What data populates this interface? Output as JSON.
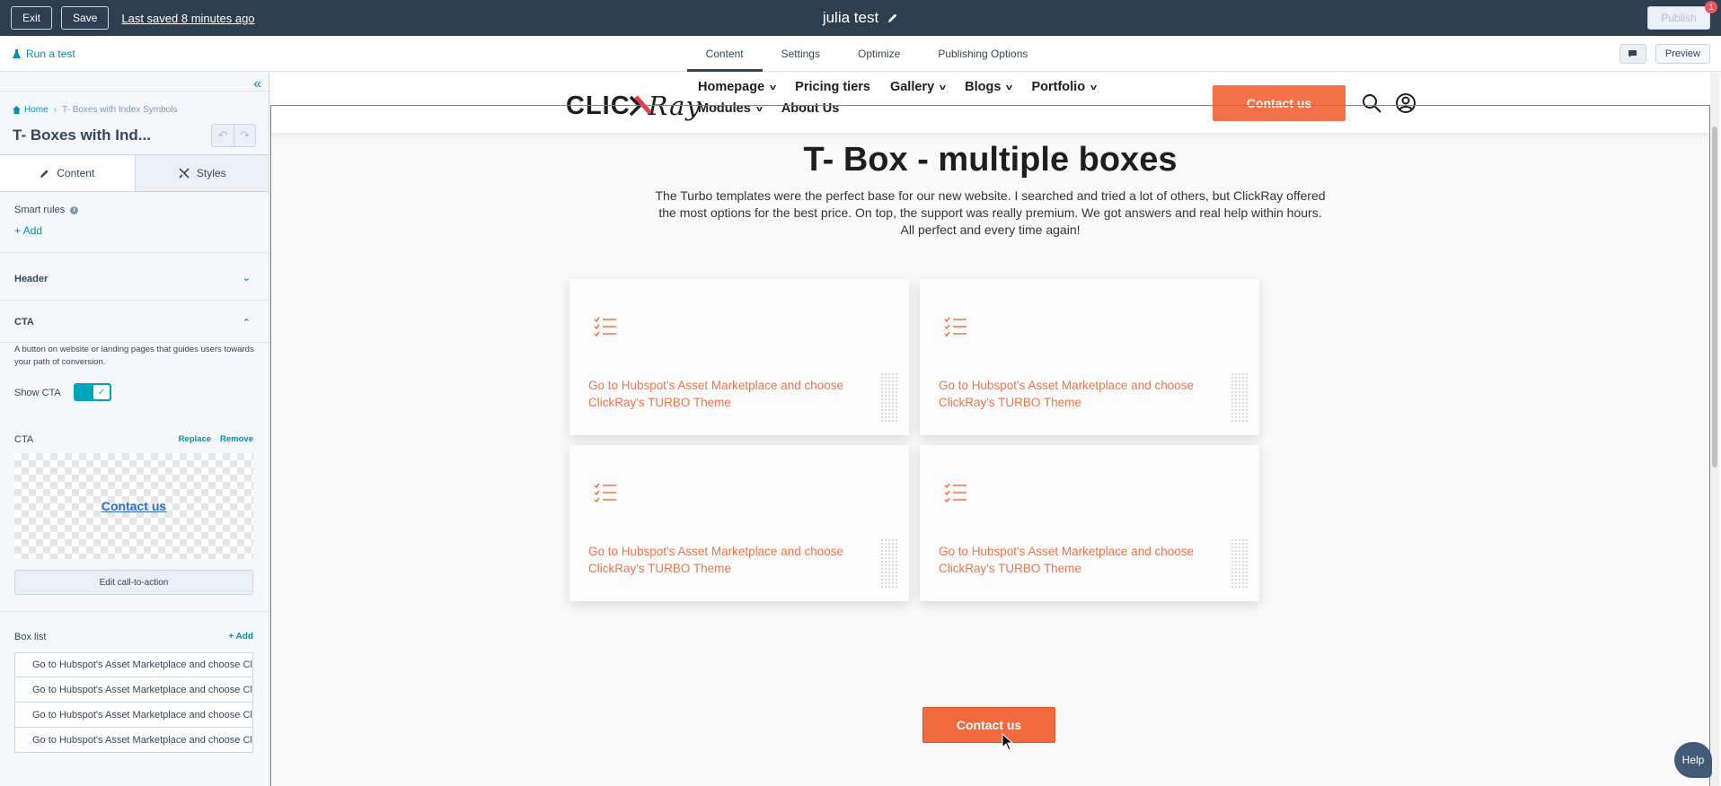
{
  "topbar": {
    "exit_label": "Exit",
    "save_label": "Save",
    "saved_text": "Last saved 8 minutes ago",
    "page_name": "julia test",
    "publish_label": "Publish",
    "notification_count": "1"
  },
  "subbar": {
    "run_test": "Run a test",
    "tabs": [
      {
        "label": "Content",
        "active": true
      },
      {
        "label": "Settings",
        "active": false
      },
      {
        "label": "Optimize",
        "active": false
      },
      {
        "label": "Publishing Options",
        "active": false
      }
    ],
    "preview_label": "Preview"
  },
  "sidebar": {
    "breadcrumb_home": "Home",
    "breadcrumb_current": "T- Boxes with Index Symbols",
    "module_title": "T- Boxes with Ind...",
    "tab_content": "Content",
    "tab_styles": "Styles",
    "smart_rules": "Smart rules",
    "add_label": "Add",
    "header_section": "Header",
    "cta_section": "CTA",
    "cta_description": "A button on website or landing pages that guides users towards your path of conversion.",
    "show_cta_label": "Show CTA",
    "show_cta_enabled": true,
    "cta_field_label": "CTA",
    "replace_label": "Replace",
    "remove_label": "Remove",
    "cta_preview_text": "Contact us",
    "edit_cta_label": "Edit call-to-action",
    "box_list_label": "Box list",
    "box_list_add": "+ Add",
    "box_items": [
      "Go to Hubspot's Asset Marketplace and choose ClickRay's TURBO Theme",
      "Go to Hubspot's Asset Marketplace and choose ClickRay's TURBO Theme",
      "Go to Hubspot's Asset Marketplace and choose ClickRay's TURBO Theme",
      "Go to Hubspot's Asset Marketplace and choose ClickRay's TURBO Theme"
    ]
  },
  "site": {
    "logo_left": "CLIC",
    "logo_right": "Ray",
    "nav": [
      "Homepage",
      "Pricing tiers",
      "Gallery",
      "Blogs",
      "Portfolio",
      "Modules",
      "About Us"
    ],
    "header_cta": "Contact us",
    "heading": "T- Box - multiple boxes",
    "lead": "The Turbo templates were the perfect base for our new website. I searched and tried a lot of others, but ClickRay offered the most options for the best price. On top, the support was really premium. We got answers and real help within hours. All perfect and every time again!",
    "cards": [
      "Go to Hubspot's Asset Marketplace and choose ClickRay's TURBO Theme",
      "Go to Hubspot's Asset Marketplace and choose ClickRay's TURBO Theme",
      "Go to Hubspot's Asset Marketplace and choose ClickRay's TURBO Theme",
      "Go to Hubspot's Asset Marketplace and choose ClickRay's TURBO Theme"
    ],
    "main_cta": "Contact us",
    "help_label": "Help"
  },
  "colors": {
    "topbar": "#2d3e50",
    "accent_orange": "#f26a3d",
    "card_text": "#f0744a",
    "link_teal": "#0091ae"
  }
}
